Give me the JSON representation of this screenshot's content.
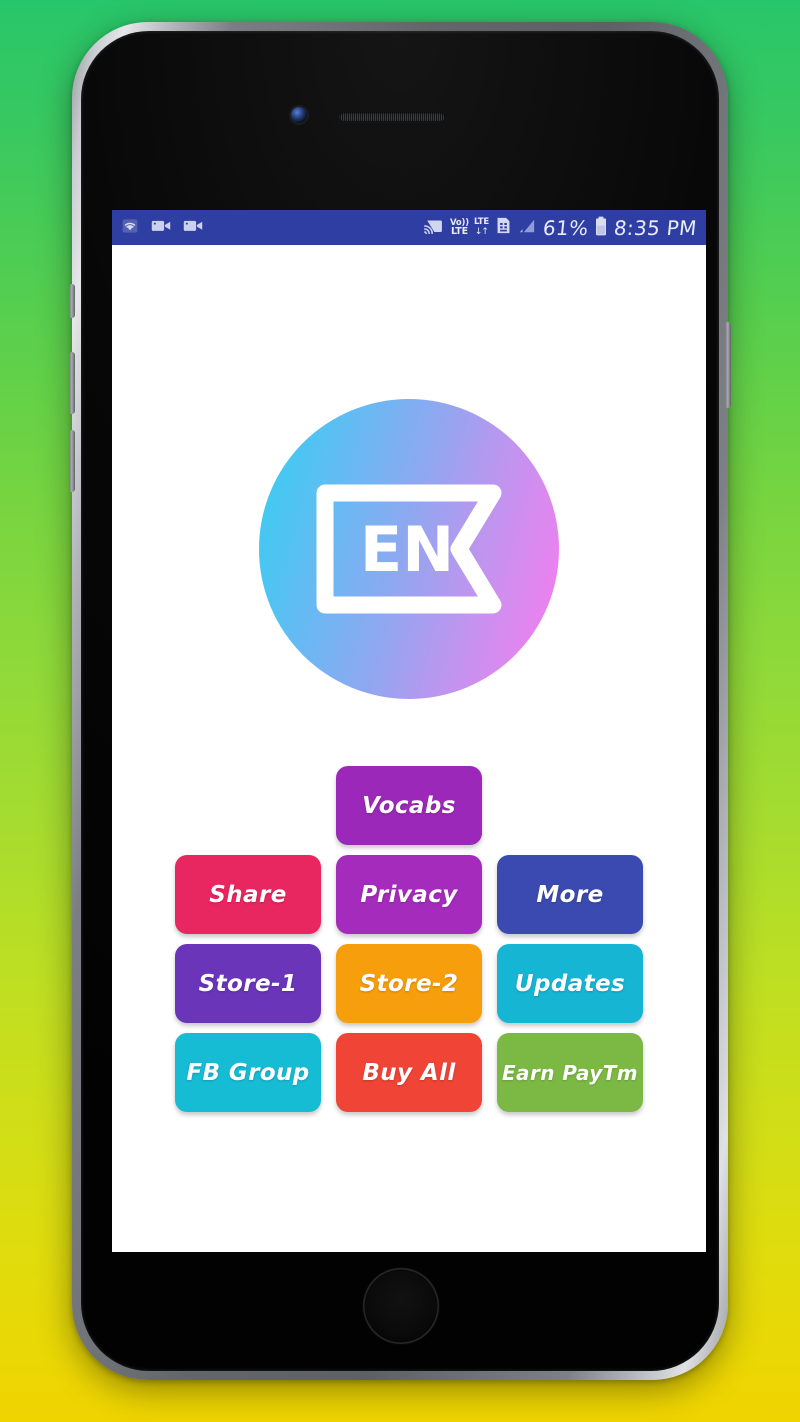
{
  "wallpaper": {
    "gradient_top": "#28c66a",
    "gradient_bottom": "#f0d400"
  },
  "device": {
    "frame_color": "#8f9297",
    "bezel_color": "#080808"
  },
  "status_bar": {
    "background": "#2f3ea2",
    "left_icons": [
      {
        "name": "wifi-icon",
        "label": "wifi"
      },
      {
        "name": "screen-record-icon-1",
        "label": "video-camera"
      },
      {
        "name": "screen-record-icon-2",
        "label": "video-camera"
      }
    ],
    "right_icons": [
      {
        "name": "cast-icon",
        "label": "cast"
      },
      {
        "name": "volte-icon",
        "top": "Vo))",
        "bottom": "LTE"
      },
      {
        "name": "lte-data-icon",
        "top": "LTE",
        "bottom": "↓↑"
      },
      {
        "name": "sim-card-icon",
        "label": "sim"
      },
      {
        "name": "signal-bars-icon",
        "label": "signal"
      }
    ],
    "battery_percent": "61%",
    "battery_icon": "battery-icon",
    "clock": "8:35 PM"
  },
  "app": {
    "logo": {
      "name": "en-app-logo",
      "text": "EN",
      "gradient_start": "#35cdf0",
      "gradient_end": "#f87df0",
      "flag_stroke": "#ffffff"
    },
    "menu_rows": [
      [
        {
          "label": "Vocabs",
          "color": "#9b28b8",
          "name": "menu-button-vocabs"
        }
      ],
      [
        {
          "label": "Share",
          "color": "#e8265f",
          "name": "menu-button-share"
        },
        {
          "label": "Privacy",
          "color": "#a52bbd",
          "name": "menu-button-privacy"
        },
        {
          "label": "More",
          "color": "#3b4ab0",
          "name": "menu-button-more"
        }
      ],
      [
        {
          "label": "Store-1",
          "color": "#6a35b8",
          "name": "menu-button-store-1"
        },
        {
          "label": "Store-2",
          "color": "#f79e0c",
          "name": "menu-button-store-2"
        },
        {
          "label": "Updates",
          "color": "#16b5d4",
          "name": "menu-button-updates"
        }
      ],
      [
        {
          "label": "FB Group",
          "color": "#16bcd4",
          "name": "menu-button-fb-group"
        },
        {
          "label": "Buy All",
          "color": "#ef4436",
          "name": "menu-button-buy-all"
        },
        {
          "label": "Earn PayTm",
          "color": "#7cb944",
          "name": "menu-button-earn-paytm"
        }
      ]
    ]
  }
}
